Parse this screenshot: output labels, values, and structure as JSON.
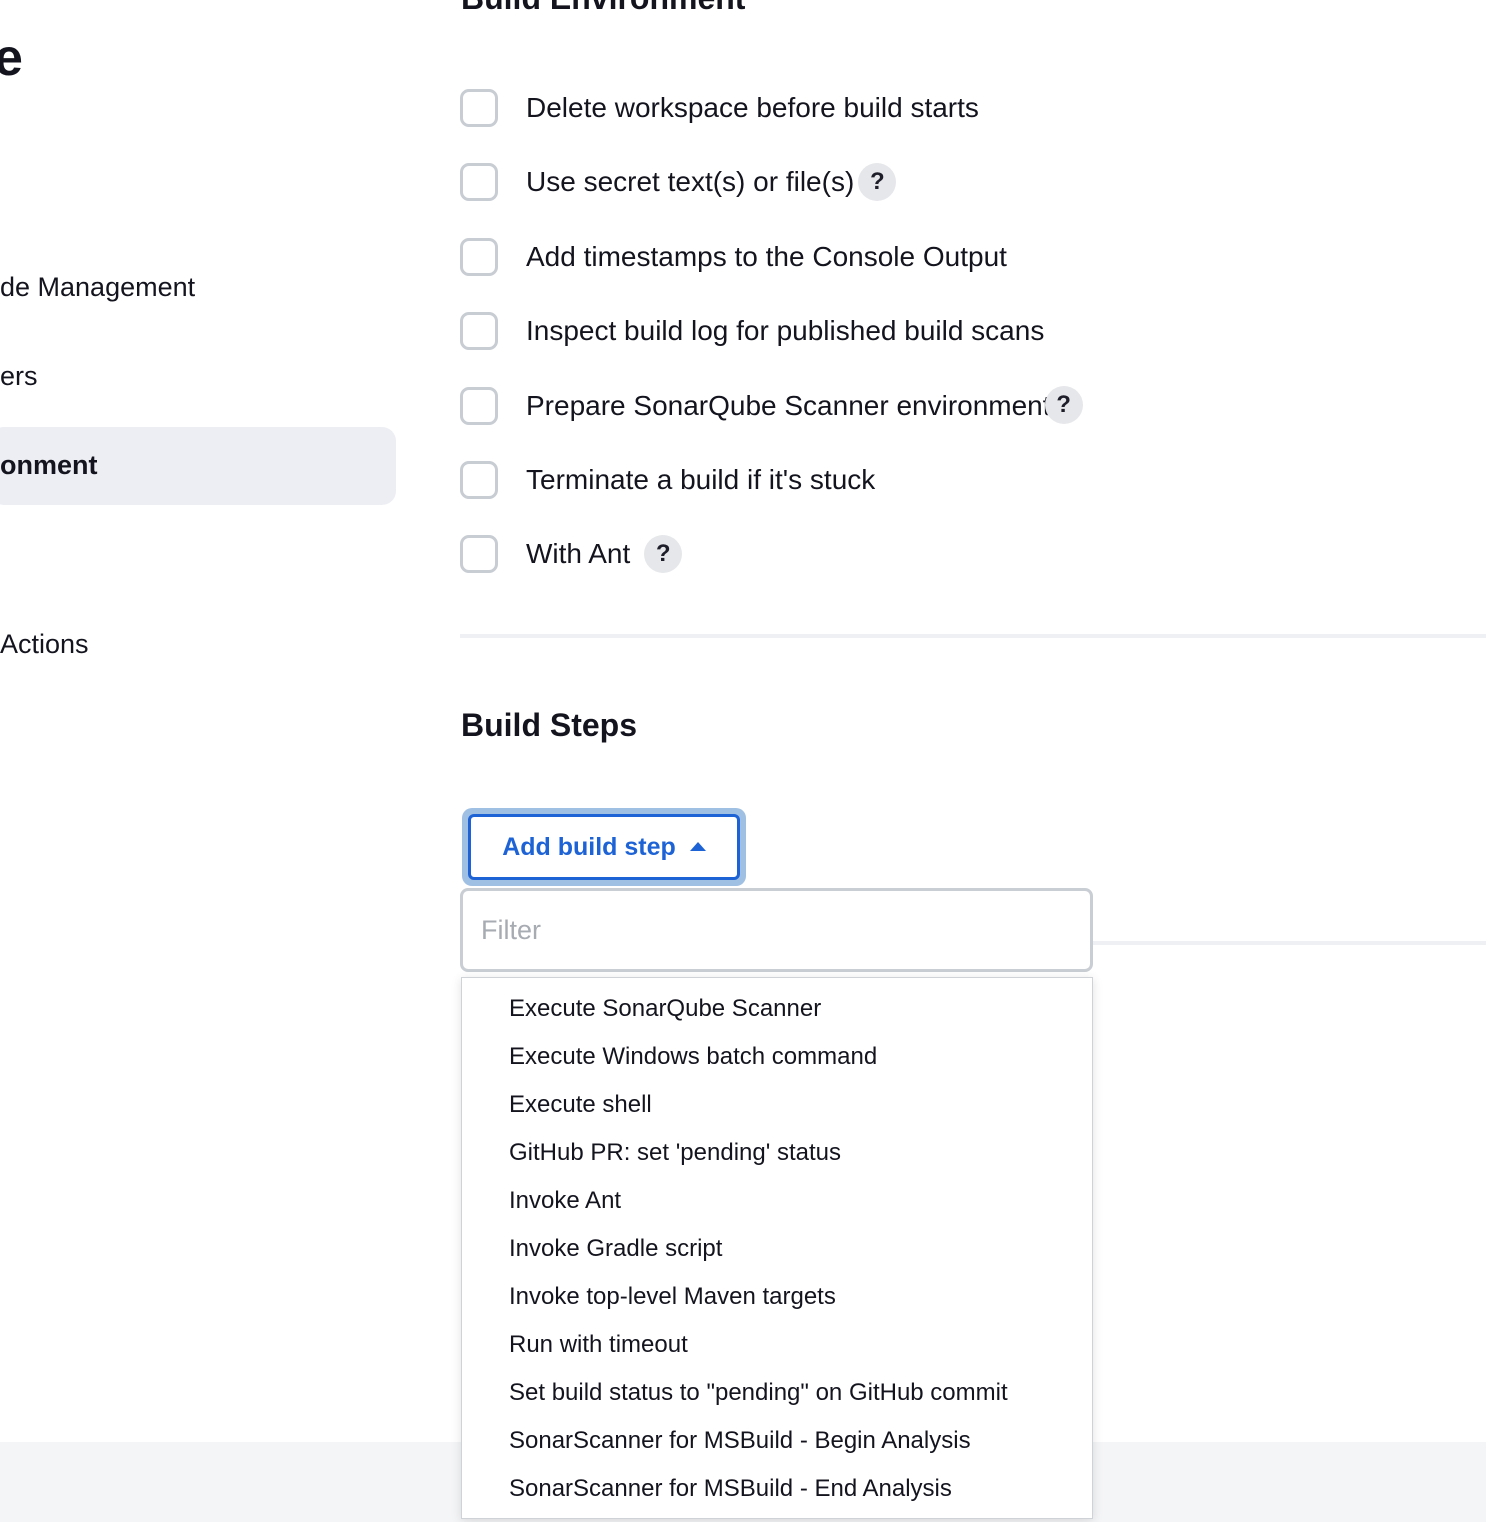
{
  "sidebar": {
    "title_fragment": "e",
    "items": [
      {
        "label": "de Management",
        "active": false
      },
      {
        "label": "ers",
        "active": false
      },
      {
        "label": "onment",
        "active": true
      },
      {
        "label": "Actions",
        "active": false
      }
    ]
  },
  "build_environment": {
    "title": "Build Environment",
    "options": [
      {
        "label": "Delete workspace before build starts",
        "help": ""
      },
      {
        "label": "Use secret text(s) or file(s)",
        "help": "?"
      },
      {
        "label": "Add timestamps to the Console Output",
        "help": ""
      },
      {
        "label": "Inspect build log for published build scans",
        "help": ""
      },
      {
        "label": "Prepare SonarQube Scanner environment",
        "help": "?"
      },
      {
        "label": "Terminate a build if it's stuck",
        "help": ""
      },
      {
        "label": "With Ant",
        "help": "?"
      }
    ]
  },
  "build_steps": {
    "title": "Build Steps",
    "add_button_label": "Add build step",
    "filter_placeholder": "Filter",
    "filter_value": "",
    "menu_items": [
      "Execute SonarQube Scanner",
      "Execute Windows batch command",
      "Execute shell",
      "GitHub PR: set 'pending' status",
      "Invoke Ant",
      "Invoke Gradle script",
      "Invoke top-level Maven targets",
      "Run with timeout",
      "Set build status to \"pending\" on GitHub commit",
      "SonarScanner for MSBuild - Begin Analysis",
      "SonarScanner for MSBuild - End Analysis"
    ]
  },
  "colors": {
    "accent": "#1d63d6",
    "focus_ring": "#9fbfe3",
    "sidebar_active_bg": "#edeef3",
    "text": "#14141f"
  }
}
